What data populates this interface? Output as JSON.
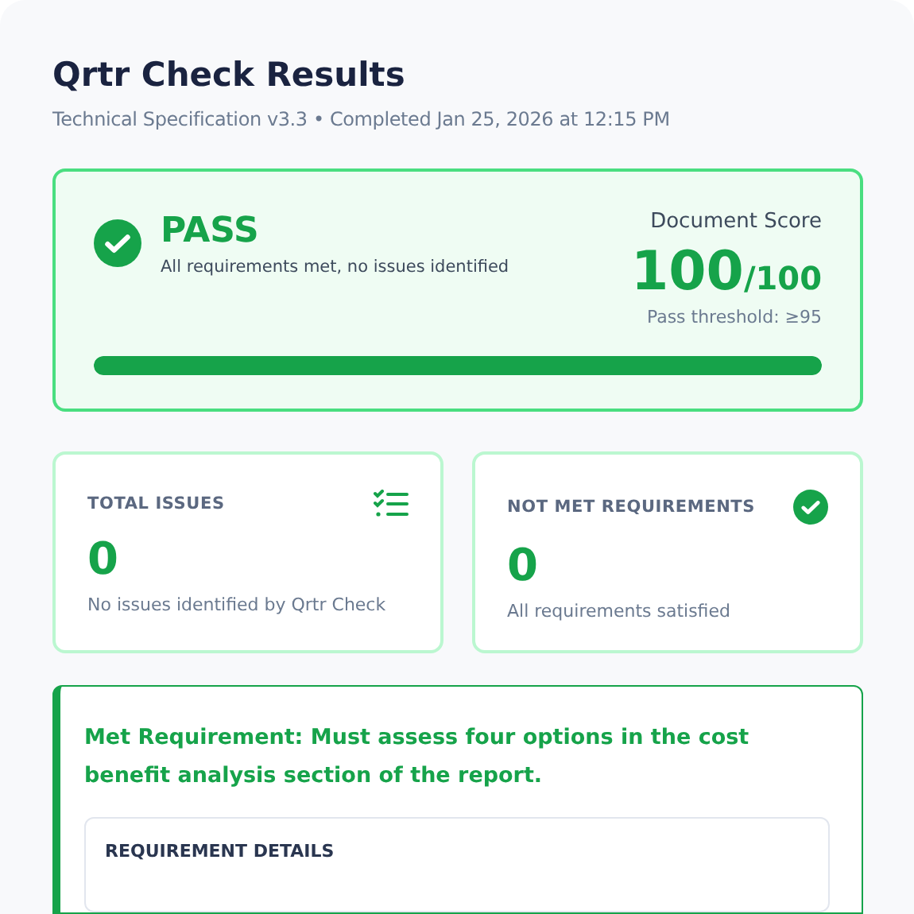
{
  "header": {
    "title": "Qrtr Check Results",
    "subtitle": "Technical Specification v3.3 • Completed Jan 25, 2026 at 12:15 PM"
  },
  "result": {
    "passed": true,
    "verdict": "PASS",
    "summary": "All requirements met, no issues identified",
    "score_label": "Document Score",
    "score": "100",
    "score_max": "/100",
    "threshold": "Pass threshold: ≥95",
    "level": 1
  },
  "stats": [
    {
      "label": "TOTAL ISSUES",
      "value": "0",
      "note": "No issues identified by Qrtr Check"
    },
    {
      "label": "NOT MET REQUIREMENTS",
      "value": "0",
      "note": "All requirements satisfied"
    }
  ],
  "requirement": {
    "met": true,
    "title": "Met Requirement: Must assess four options in the cost benefit analysis section of the report.",
    "details_heading": "REQUIREMENT DETAILS"
  }
}
